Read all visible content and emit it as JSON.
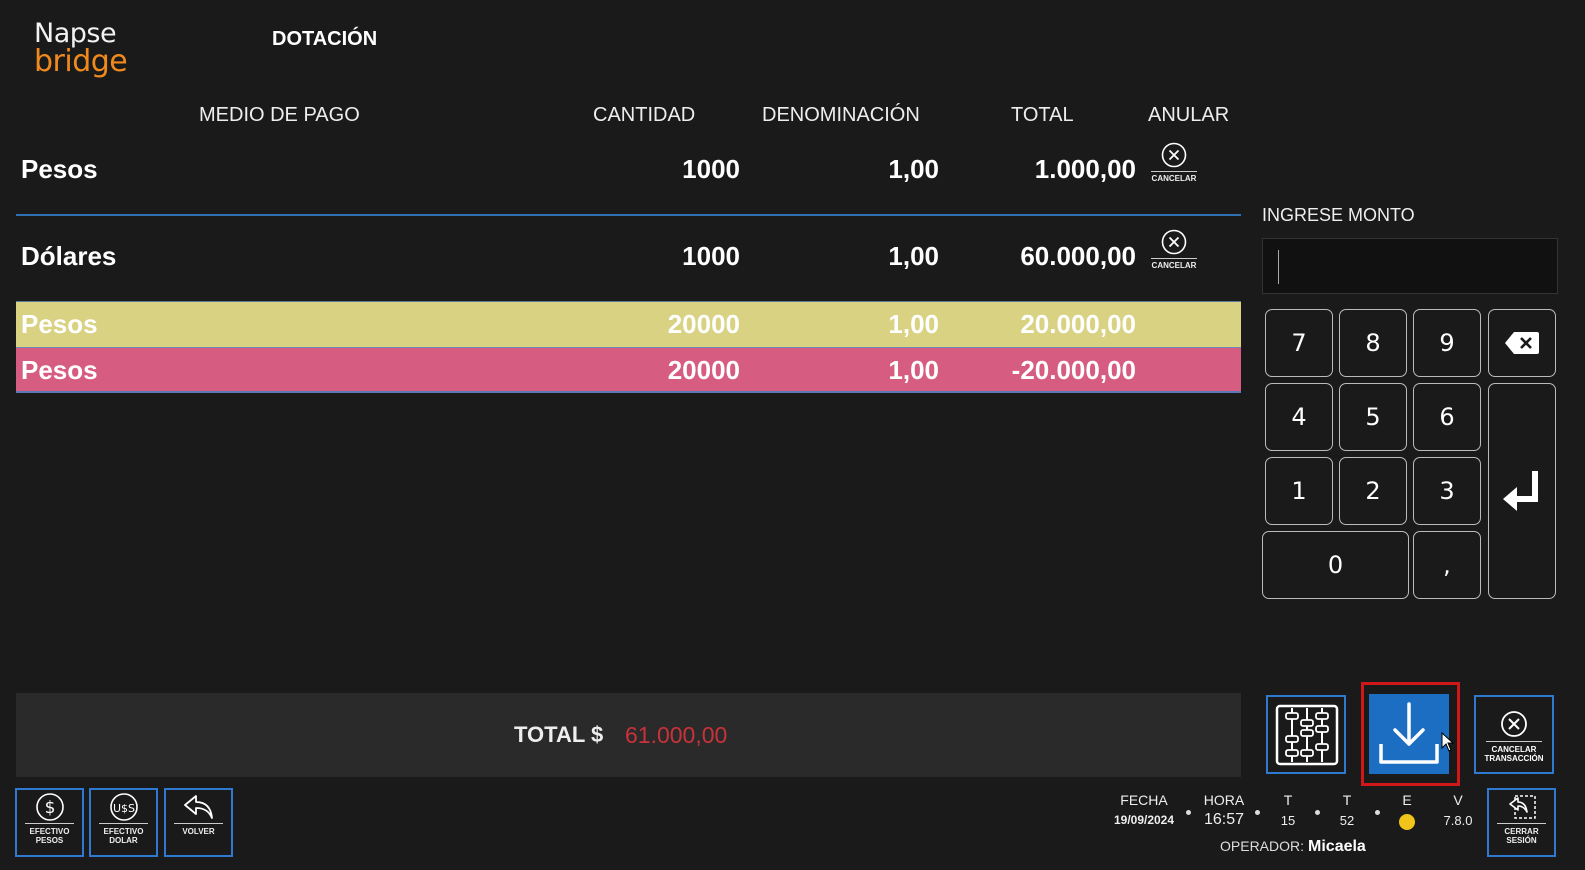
{
  "app": {
    "logo_line1": "Napse",
    "logo_line2": "bridge",
    "page_title": "DOTACIÓN"
  },
  "table": {
    "headers": {
      "medio": "MEDIO DE PAGO",
      "cantidad": "CANTIDAD",
      "denominacion": "DENOMINACIÓN",
      "total": "TOTAL",
      "anular": "ANULAR"
    },
    "rows": [
      {
        "medio": "Pesos",
        "cantidad": "1000",
        "denominacion": "1,00",
        "total": "1.000,00",
        "cancel_label": "CANCELAR"
      },
      {
        "medio": "Dólares",
        "cantidad": "1000",
        "denominacion": "1,00",
        "total": "60.000,00",
        "cancel_label": "CANCELAR"
      },
      {
        "medio": "Pesos",
        "cantidad": "20000",
        "denominacion": "1,00",
        "total": "20.000,00"
      },
      {
        "medio": "Pesos",
        "cantidad": "20000",
        "denominacion": "1,00",
        "total": "-20.000,00"
      }
    ]
  },
  "keypad": {
    "label": "INGRESE MONTO",
    "input_value": "",
    "keys": {
      "k7": "7",
      "k8": "8",
      "k9": "9",
      "k4": "4",
      "k5": "5",
      "k6": "6",
      "k1": "1",
      "k2": "2",
      "k3": "3",
      "k0": "0",
      "comma": ","
    }
  },
  "totals": {
    "label": "TOTAL $",
    "value": "61.000,00"
  },
  "actions": {
    "cancel_transaction_label": "CANCELAR TRANSACCIÓN"
  },
  "bottom_buttons": {
    "efectivo_pesos": "EFECTIVO PESOS",
    "efectivo_dolar": "EFECTIVO DOLAR",
    "volver": "VOLVER",
    "cerrar_sesion": "CERRAR SESIÓN"
  },
  "status_bar": {
    "fecha_label": "FECHA",
    "fecha": "19/09/2024",
    "hora_label": "HORA",
    "hora": "16:57",
    "t1_label": "T",
    "t1": "15",
    "t2_label": "T",
    "t2": "52",
    "e_label": "E",
    "v_label": "V",
    "version": "7.8.0",
    "operador_label": "OPERADOR:",
    "operador": "Micaela"
  },
  "colors": {
    "row_yellow": "#d8d282",
    "row_pink": "#d75c82",
    "accent_blue": "#1c6ec2",
    "total_red": "#c8323b",
    "logo_orange": "#f08a1e"
  }
}
